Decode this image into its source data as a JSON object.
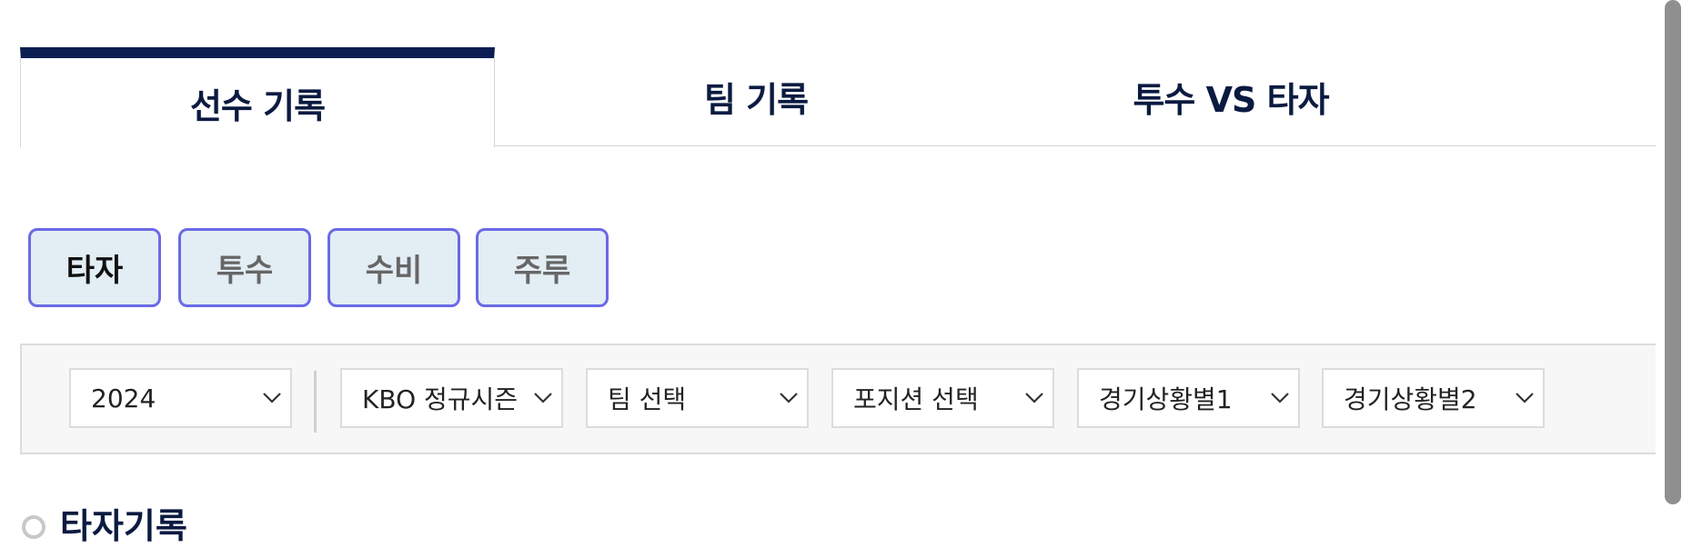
{
  "tabs": [
    {
      "label": "선수 기록",
      "active": true
    },
    {
      "label": "팀 기록",
      "active": false
    },
    {
      "label": "투수 VS 타자",
      "active": false
    }
  ],
  "subtabs": [
    {
      "label": "타자",
      "active": true
    },
    {
      "label": "투수",
      "active": false
    },
    {
      "label": "수비",
      "active": false
    },
    {
      "label": "주루",
      "active": false
    }
  ],
  "filters": {
    "season_year": "2024",
    "series": "KBO 정규시즌",
    "team": "팀 선택",
    "position": "포지션 선택",
    "situation1": "경기상황별1",
    "situation2": "경기상황별2"
  },
  "section": {
    "title": "타자기록"
  },
  "colors": {
    "navy": "#0b1e52",
    "subtab_border": "#6a6ae6",
    "subtab_bg": "#e3edf4"
  }
}
